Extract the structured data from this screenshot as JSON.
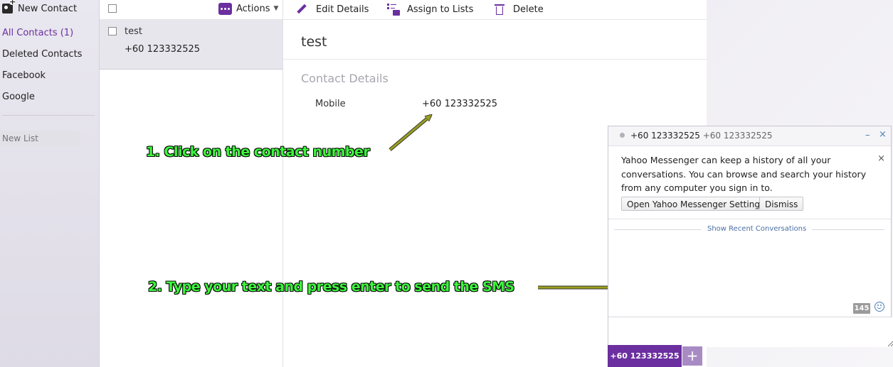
{
  "sidebar": {
    "new_contact": "New Contact",
    "items": [
      {
        "label": "All Contacts (1)"
      },
      {
        "label": "Deleted Contacts"
      },
      {
        "label": "Facebook"
      },
      {
        "label": "Google"
      }
    ],
    "new_list_placeholder": "New List"
  },
  "list": {
    "actions_label": "Actions",
    "contacts": [
      {
        "name": "test",
        "phone": "+60 123332525"
      }
    ]
  },
  "toolbar": {
    "edit_label": "Edit Details",
    "assign_label": "Assign to Lists",
    "delete_label": "Delete"
  },
  "detail": {
    "name": "test",
    "section_title": "Contact Details",
    "fields": [
      {
        "label": "Mobile",
        "value": "+60 123332525"
      }
    ]
  },
  "annotations": {
    "step1": "1. Click on the contact number",
    "step2": "2. Type your text and press enter to send the SMS"
  },
  "chat": {
    "title": "+60 123332525",
    "subtitle": "+60 123332525",
    "minimize": "–",
    "close": "×",
    "notice_text": "Yahoo Messenger can keep a history of all your conversations. You can browse and search your history from any computer you sign in to.",
    "notice_close": "×",
    "settings_button": "Open Yahoo Messenger Settings",
    "dismiss_button": "Dismiss",
    "recent_link": "Show Recent Conversations",
    "char_count": "145",
    "tab_label": "+60 123332525",
    "add_tab": "+"
  },
  "colors": {
    "accent": "#6b2fa0",
    "annotation_text": "#3cf53c",
    "arrow": "#9aa01e"
  }
}
